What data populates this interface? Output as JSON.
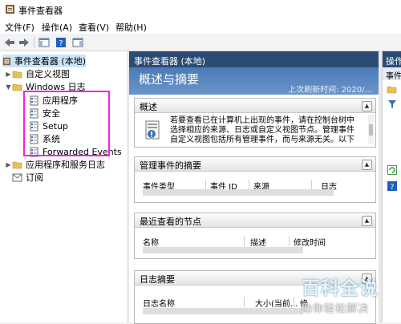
{
  "window": {
    "title": "事件查看器"
  },
  "menu": [
    "文件(F)",
    "操作(A)",
    "查看(V)",
    "帮助(H)"
  ],
  "tree": {
    "root": "事件查看器 (本地)",
    "custom_views": "自定义视图",
    "windows_logs": "Windows 日志",
    "logs": [
      "应用程序",
      "安全",
      "Setup",
      "系统",
      "Forwarded Events"
    ],
    "app_service_logs": "应用程序和服务日志",
    "subscriptions": "订阅"
  },
  "center": {
    "header": "事件查看器 (本地)",
    "overview_title": "概述与摘要",
    "last_refresh": "上次刷新时间: 2020/...",
    "overview_section": {
      "title": "概述",
      "text_lines": [
        "若要查看已在计算机上出现的事件，请在控制台树中",
        "选择相应的来源、日志或自定义视图节点。管理事件",
        "自定义视图包括所有管理事件，而与来源无关。以下"
      ]
    },
    "admin_events": {
      "title": "管理事件的摘要",
      "columns": [
        "事件类型",
        "事件 ID",
        "来源",
        "日志"
      ]
    },
    "recent_nodes": {
      "title": "最近查看的节点",
      "columns": [
        "名称",
        "描述",
        "修改时间"
      ]
    },
    "log_summary": {
      "title": "日志摘要",
      "columns": [
        "日志名称",
        "大小(当前...",
        "修"
      ]
    }
  },
  "actions": {
    "header": "操作",
    "sub": "事件"
  },
  "watermark": {
    "title": "百科全说",
    "subtitle": "助你轻松解决"
  },
  "colors": {
    "header_bg": "#2b4b74",
    "highlight": "#ff1be3",
    "selection": "#cce4f7"
  }
}
